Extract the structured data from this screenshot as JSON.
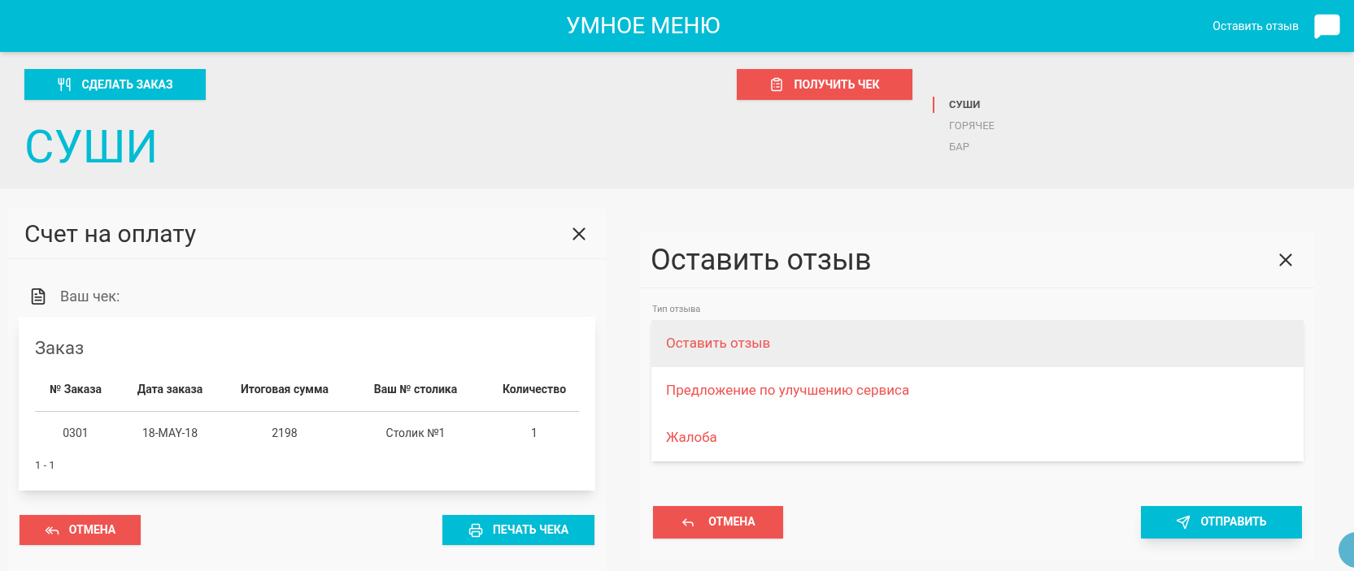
{
  "header": {
    "title": "УМНОЕ МЕНЮ",
    "feedback_link": "Оставить отзыв"
  },
  "toolbar": {
    "order_button": "СДЕЛАТЬ ЗАКАЗ",
    "receipt_button": "ПОЛУЧИТЬ ЧЕК"
  },
  "section_title": "СУШИ",
  "nav": [
    {
      "label": "СУШИ",
      "selected": true
    },
    {
      "label": "ГОРЯЧЕЕ",
      "selected": false
    },
    {
      "label": "БАР",
      "selected": false
    }
  ],
  "bill_dialog": {
    "title": "Счет на оплату",
    "receipt_label": "Ваш чек:",
    "card_title": "Заказ",
    "columns": [
      "№ Заказа",
      "Дата заказа",
      "Итоговая сумма",
      "Ваш № столика",
      "Количество"
    ],
    "rows": [
      [
        "0301",
        "18-MAY-18",
        "2198",
        "Столик №1",
        "1"
      ]
    ],
    "pagination": "1 - 1",
    "cancel_button": "ОТМЕНА",
    "print_button": "ПЕЧАТЬ ЧЕКА"
  },
  "feedback_dialog": {
    "title": "Оставить отзыв",
    "field_label": "Тип отзыва",
    "options": [
      {
        "label": "Оставить отзыв",
        "selected": true
      },
      {
        "label": "Предложение по улучшению сервиса",
        "selected": false
      },
      {
        "label": "Жалоба",
        "selected": false
      }
    ],
    "cancel_button": "ОТМЕНА",
    "submit_button": "ОТПРАВИТЬ"
  }
}
